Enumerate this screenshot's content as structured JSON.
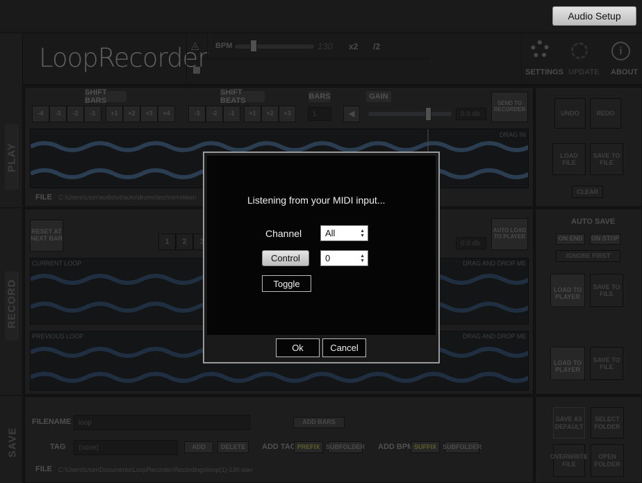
{
  "top": {
    "audio_setup": "Audio Setup"
  },
  "header": {
    "logo": "LoopRecorder",
    "bpm_label": "BPM",
    "bpm_value": "130",
    "x2": "x2",
    "div2": "/2",
    "settings": "SETTINGS",
    "update": "UPDATE",
    "about": "ABOUT"
  },
  "sides": {
    "play": "PLAY",
    "record": "RECORD",
    "save": "SAVE"
  },
  "play": {
    "shift_bars": "SHIFT BARS",
    "shift_bars_buttons": [
      "-4",
      "-3",
      "-2",
      "-1",
      "+1",
      "+2",
      "+3",
      "+4"
    ],
    "shift_beats": "SHIFT BEATS",
    "shift_beats_buttons": [
      "-3",
      "-2",
      "-1",
      "+1",
      "+2",
      "+3"
    ],
    "bars": "BARS",
    "bars_value": "1",
    "gain": "GAIN",
    "gain_db": "0.0 db",
    "send_to_recorder": "SEND TO RECORDER",
    "drag_in": "DRAG IN",
    "file_label": "FILE",
    "file_path": "C:\\Users\\User\\audio\\xtracks\\drums\\techno\\rekken"
  },
  "play_right": {
    "undo": "UNDO",
    "redo": "REDO",
    "load_file": "LOAD FILE",
    "save_to_file": "SAVE TO FILE",
    "clear": "CLEAR"
  },
  "record": {
    "reset_at_next_bar": "RESET AT NEXT BAR",
    "bar_buttons": [
      "1",
      "2",
      "3"
    ],
    "gain_db": "0.0 db",
    "auto_load_to_player": "AUTO LOAD TO PLAYER",
    "current_loop": "CURRENT LOOP",
    "previous_loop": "PREVIOUS LOOP",
    "drag_and_drop": "DRAG AND DROP ME"
  },
  "record_right": {
    "auto_save": "AUTO SAVE",
    "on_end": "ON END",
    "on_stop": "ON STOP",
    "ignore_first": "IGNORE FIRST",
    "load_to_player": "LOAD TO PLAYER",
    "save_to_file": "SAVE TO FILE"
  },
  "save": {
    "filename_label": "FILENAME",
    "filename_value": "loop",
    "add_bars": "ADD BARS",
    "tag_label": "TAG",
    "tag_value": "(none)",
    "add": "ADD",
    "delete": "DELETE",
    "add_tag": "ADD TAG",
    "prefix": "PREFIX",
    "subfolder": "SUBFOLDER",
    "add_bpm": "ADD BPM",
    "suffix": "SUFFIX",
    "file_label": "FILE",
    "file_path": "C:\\Users\\User\\Documents\\LoopRecorder\\Recordings\\loop(1)-130.wav"
  },
  "save_right": {
    "save_as_default": "SAVE AS DEFAULT",
    "select_folder": "SELECT FOLDER",
    "overwrite_file": "OVERWRITE FILE",
    "open_folder": "OPEN FOLDER"
  },
  "dialog": {
    "message": "Listening from your MIDI input...",
    "channel_label": "Channel",
    "channel_value": "All",
    "control_label": "Control",
    "control_value": "0",
    "toggle_label": "Toggle",
    "ok": "Ok",
    "cancel": "Cancel"
  },
  "colors": {
    "wave": "#3e5a78",
    "accent": "#b8b8b8"
  }
}
